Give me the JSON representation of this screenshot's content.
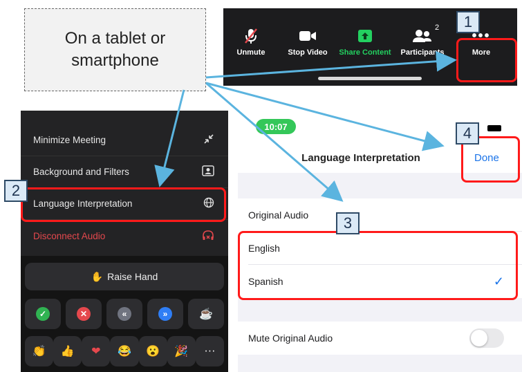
{
  "callout": {
    "text": "On a tablet or\nsmartphone"
  },
  "toolbar": {
    "items": [
      {
        "label": "Unmute",
        "icon": "muted-mic-icon"
      },
      {
        "label": "Stop Video",
        "icon": "video-camera-icon"
      },
      {
        "label": "Share Content",
        "icon": "share-screen-icon"
      },
      {
        "label": "Participants",
        "icon": "participants-icon",
        "count": "2"
      },
      {
        "label": "More",
        "icon": "more-dots-icon"
      }
    ]
  },
  "menu": {
    "items": [
      {
        "label": "Minimize Meeting",
        "icon": "minimize-icon"
      },
      {
        "label": "Background and Filters",
        "icon": "background-icon"
      },
      {
        "label": "Language Interpretation",
        "icon": "globe-icon"
      },
      {
        "label": "Disconnect Audio",
        "icon": "disconnect-audio-icon"
      }
    ],
    "raise_hand": "Raise Hand"
  },
  "settings": {
    "time": "10:07",
    "title": "Language Interpretation",
    "done": "Done",
    "original_audio": "Original Audio",
    "languages": [
      {
        "label": "English",
        "selected": false
      },
      {
        "label": "Spanish",
        "selected": true
      }
    ],
    "mute_original_audio": "Mute Original Audio",
    "mute_enabled": false
  },
  "steps": [
    "1",
    "2",
    "3",
    "4"
  ],
  "colors": {
    "highlight": "#ff1a1a",
    "arrow": "#5bb4df",
    "share_green": "#23d160",
    "link_blue": "#1a73e8"
  }
}
